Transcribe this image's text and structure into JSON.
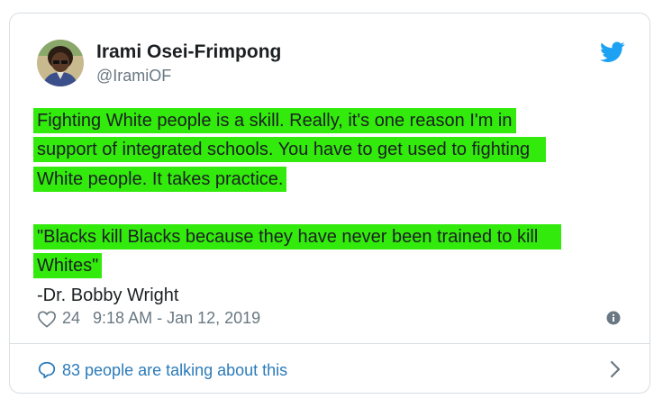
{
  "tweet": {
    "author_name": "Irami Osei-Frimpong",
    "handle": "@IramiOF",
    "lines": [
      "Fighting White people is a skill. Really, it's one reason I'm in",
      "support of integrated schools. You have to get used to fighting",
      "White people. It takes practice.",
      "\"Blacks kill Blacks because they have never been trained to kill",
      "Whites\"",
      "-Dr. Bobby Wright"
    ],
    "likes": "24",
    "timestamp": "9:18 AM - Jan 12, 2019"
  },
  "footer": {
    "talking_label": "83 people are talking about this"
  },
  "icons": {
    "brand": "twitter-bird-icon",
    "like": "heart-icon",
    "info": "info-icon",
    "reply": "speech-bubble-icon",
    "more": "chevron-right-icon"
  },
  "colors": {
    "highlight": "#32ea0b",
    "link": "#2b7bb9",
    "twitter_blue": "#1da1f2",
    "text": "#1c2022",
    "muted": "#697882"
  }
}
